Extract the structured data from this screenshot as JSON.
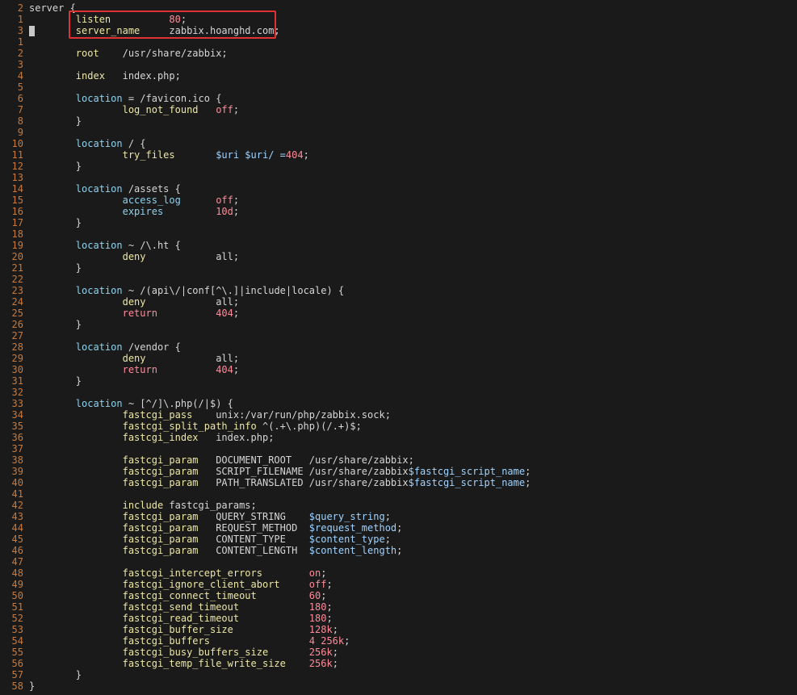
{
  "lines": [
    {
      "num": "2",
      "tokens": [
        {
          "t": "server {",
          "c": "plain"
        }
      ]
    },
    {
      "num": "1",
      "tokens": [
        {
          "t": "        listen          ",
          "c": "kw"
        },
        {
          "t": "80",
          "c": "num"
        },
        {
          "t": ";",
          "c": "plain"
        }
      ]
    },
    {
      "num": "3",
      "tokens": [
        {
          "t": "        server_name     ",
          "c": "kw"
        },
        {
          "t": "zabbix.hoanghd.com;",
          "c": "plain"
        }
      ]
    },
    {
      "num": "1",
      "tokens": []
    },
    {
      "num": "2",
      "tokens": [
        {
          "t": "        root    ",
          "c": "kw"
        },
        {
          "t": "/usr/share/zabbix;",
          "c": "plain"
        }
      ]
    },
    {
      "num": "3",
      "tokens": []
    },
    {
      "num": "4",
      "tokens": [
        {
          "t": "        index   ",
          "c": "kw"
        },
        {
          "t": "index.php;",
          "c": "plain"
        }
      ]
    },
    {
      "num": "5",
      "tokens": []
    },
    {
      "num": "6",
      "tokens": [
        {
          "t": "        location ",
          "c": "dir"
        },
        {
          "t": "= /favicon.ico {",
          "c": "plain"
        }
      ]
    },
    {
      "num": "7",
      "tokens": [
        {
          "t": "                log_not_found   ",
          "c": "kw"
        },
        {
          "t": "off",
          "c": "num"
        },
        {
          "t": ";",
          "c": "plain"
        }
      ]
    },
    {
      "num": "8",
      "tokens": [
        {
          "t": "        }",
          "c": "plain"
        }
      ]
    },
    {
      "num": "9",
      "tokens": []
    },
    {
      "num": "10",
      "tokens": [
        {
          "t": "        location ",
          "c": "dir"
        },
        {
          "t": "/ {",
          "c": "plain"
        }
      ]
    },
    {
      "num": "11",
      "tokens": [
        {
          "t": "                try_files       ",
          "c": "kw"
        },
        {
          "t": "$uri $uri/ =",
          "c": "var"
        },
        {
          "t": "404",
          "c": "num"
        },
        {
          "t": ";",
          "c": "plain"
        }
      ]
    },
    {
      "num": "12",
      "tokens": [
        {
          "t": "        }",
          "c": "plain"
        }
      ]
    },
    {
      "num": "13",
      "tokens": []
    },
    {
      "num": "14",
      "tokens": [
        {
          "t": "        location ",
          "c": "dir"
        },
        {
          "t": "/assets {",
          "c": "plain"
        }
      ]
    },
    {
      "num": "15",
      "tokens": [
        {
          "t": "                access_log      ",
          "c": "dir"
        },
        {
          "t": "off",
          "c": "num"
        },
        {
          "t": ";",
          "c": "plain"
        }
      ]
    },
    {
      "num": "16",
      "tokens": [
        {
          "t": "                expires         ",
          "c": "dir"
        },
        {
          "t": "10d",
          "c": "num"
        },
        {
          "t": ";",
          "c": "plain"
        }
      ]
    },
    {
      "num": "17",
      "tokens": [
        {
          "t": "        }",
          "c": "plain"
        }
      ]
    },
    {
      "num": "18",
      "tokens": []
    },
    {
      "num": "19",
      "tokens": [
        {
          "t": "        location ",
          "c": "dir"
        },
        {
          "t": "~ /\\.ht {",
          "c": "plain"
        }
      ]
    },
    {
      "num": "20",
      "tokens": [
        {
          "t": "                deny            ",
          "c": "kw"
        },
        {
          "t": "all;",
          "c": "plain"
        }
      ]
    },
    {
      "num": "21",
      "tokens": [
        {
          "t": "        }",
          "c": "plain"
        }
      ]
    },
    {
      "num": "22",
      "tokens": []
    },
    {
      "num": "23",
      "tokens": [
        {
          "t": "        location ",
          "c": "dir"
        },
        {
          "t": "~ /(api\\/|conf[^\\.]|include|locale) {",
          "c": "plain"
        }
      ]
    },
    {
      "num": "24",
      "tokens": [
        {
          "t": "                deny            ",
          "c": "kw"
        },
        {
          "t": "all;",
          "c": "plain"
        }
      ]
    },
    {
      "num": "25",
      "tokens": [
        {
          "t": "                return          ",
          "c": "num"
        },
        {
          "t": "404",
          "c": "num"
        },
        {
          "t": ";",
          "c": "plain"
        }
      ]
    },
    {
      "num": "26",
      "tokens": [
        {
          "t": "        }",
          "c": "plain"
        }
      ]
    },
    {
      "num": "27",
      "tokens": []
    },
    {
      "num": "28",
      "tokens": [
        {
          "t": "        location ",
          "c": "dir"
        },
        {
          "t": "/vendor {",
          "c": "plain"
        }
      ]
    },
    {
      "num": "29",
      "tokens": [
        {
          "t": "                deny            ",
          "c": "kw"
        },
        {
          "t": "all;",
          "c": "plain"
        }
      ]
    },
    {
      "num": "30",
      "tokens": [
        {
          "t": "                return          ",
          "c": "num"
        },
        {
          "t": "404",
          "c": "num"
        },
        {
          "t": ";",
          "c": "plain"
        }
      ]
    },
    {
      "num": "31",
      "tokens": [
        {
          "t": "        }",
          "c": "plain"
        }
      ]
    },
    {
      "num": "32",
      "tokens": []
    },
    {
      "num": "33",
      "tokens": [
        {
          "t": "        location ",
          "c": "dir"
        },
        {
          "t": "~ [^/]\\.php(/|$) {",
          "c": "plain"
        }
      ]
    },
    {
      "num": "34",
      "tokens": [
        {
          "t": "                fastcgi_pass    ",
          "c": "kw"
        },
        {
          "t": "unix:/var/run/php/zabbix.sock;",
          "c": "plain"
        }
      ]
    },
    {
      "num": "35",
      "tokens": [
        {
          "t": "                fastcgi_split_path_info ",
          "c": "kw"
        },
        {
          "t": "^(.+\\.php)(/.+)$;",
          "c": "plain"
        }
      ]
    },
    {
      "num": "36",
      "tokens": [
        {
          "t": "                fastcgi_index   ",
          "c": "kw"
        },
        {
          "t": "index.php;",
          "c": "plain"
        }
      ]
    },
    {
      "num": "37",
      "tokens": []
    },
    {
      "num": "38",
      "tokens": [
        {
          "t": "                fastcgi_param   ",
          "c": "kw"
        },
        {
          "t": "DOCUMENT_ROOT   /usr/share/zabbix;",
          "c": "plain"
        }
      ]
    },
    {
      "num": "39",
      "tokens": [
        {
          "t": "                fastcgi_param   ",
          "c": "kw"
        },
        {
          "t": "SCRIPT_FILENAME /usr/share/zabbix",
          "c": "plain"
        },
        {
          "t": "$fastcgi_script_name",
          "c": "var"
        },
        {
          "t": ";",
          "c": "plain"
        }
      ]
    },
    {
      "num": "40",
      "tokens": [
        {
          "t": "                fastcgi_param   ",
          "c": "kw"
        },
        {
          "t": "PATH_TRANSLATED /usr/share/zabbix",
          "c": "plain"
        },
        {
          "t": "$fastcgi_script_name",
          "c": "var"
        },
        {
          "t": ";",
          "c": "plain"
        }
      ]
    },
    {
      "num": "41",
      "tokens": []
    },
    {
      "num": "42",
      "tokens": [
        {
          "t": "                include ",
          "c": "kw"
        },
        {
          "t": "fastcgi_params;",
          "c": "plain"
        }
      ]
    },
    {
      "num": "43",
      "tokens": [
        {
          "t": "                fastcgi_param   ",
          "c": "kw"
        },
        {
          "t": "QUERY_STRING    ",
          "c": "plain"
        },
        {
          "t": "$query_string",
          "c": "var"
        },
        {
          "t": ";",
          "c": "plain"
        }
      ]
    },
    {
      "num": "44",
      "tokens": [
        {
          "t": "                fastcgi_param   ",
          "c": "kw"
        },
        {
          "t": "REQUEST_METHOD  ",
          "c": "plain"
        },
        {
          "t": "$request_method",
          "c": "var"
        },
        {
          "t": ";",
          "c": "plain"
        }
      ]
    },
    {
      "num": "45",
      "tokens": [
        {
          "t": "                fastcgi_param   ",
          "c": "kw"
        },
        {
          "t": "CONTENT_TYPE    ",
          "c": "plain"
        },
        {
          "t": "$content_type",
          "c": "var"
        },
        {
          "t": ";",
          "c": "plain"
        }
      ]
    },
    {
      "num": "46",
      "tokens": [
        {
          "t": "                fastcgi_param   ",
          "c": "kw"
        },
        {
          "t": "CONTENT_LENGTH  ",
          "c": "plain"
        },
        {
          "t": "$content_length",
          "c": "var"
        },
        {
          "t": ";",
          "c": "plain"
        }
      ]
    },
    {
      "num": "47",
      "tokens": []
    },
    {
      "num": "48",
      "tokens": [
        {
          "t": "                fastcgi_intercept_errors        ",
          "c": "kw"
        },
        {
          "t": "on",
          "c": "num"
        },
        {
          "t": ";",
          "c": "plain"
        }
      ]
    },
    {
      "num": "49",
      "tokens": [
        {
          "t": "                fastcgi_ignore_client_abort     ",
          "c": "kw"
        },
        {
          "t": "off",
          "c": "num"
        },
        {
          "t": ";",
          "c": "plain"
        }
      ]
    },
    {
      "num": "50",
      "tokens": [
        {
          "t": "                fastcgi_connect_timeout         ",
          "c": "kw"
        },
        {
          "t": "60",
          "c": "num"
        },
        {
          "t": ";",
          "c": "plain"
        }
      ]
    },
    {
      "num": "51",
      "tokens": [
        {
          "t": "                fastcgi_send_timeout            ",
          "c": "kw"
        },
        {
          "t": "180",
          "c": "num"
        },
        {
          "t": ";",
          "c": "plain"
        }
      ]
    },
    {
      "num": "52",
      "tokens": [
        {
          "t": "                fastcgi_read_timeout            ",
          "c": "kw"
        },
        {
          "t": "180",
          "c": "num"
        },
        {
          "t": ";",
          "c": "plain"
        }
      ]
    },
    {
      "num": "53",
      "tokens": [
        {
          "t": "                fastcgi_buffer_size             ",
          "c": "kw"
        },
        {
          "t": "128k",
          "c": "num"
        },
        {
          "t": ";",
          "c": "plain"
        }
      ]
    },
    {
      "num": "54",
      "tokens": [
        {
          "t": "                fastcgi_buffers                 ",
          "c": "kw"
        },
        {
          "t": "4 256k",
          "c": "num"
        },
        {
          "t": ";",
          "c": "plain"
        }
      ]
    },
    {
      "num": "55",
      "tokens": [
        {
          "t": "                fastcgi_busy_buffers_size       ",
          "c": "kw"
        },
        {
          "t": "256k",
          "c": "num"
        },
        {
          "t": ";",
          "c": "plain"
        }
      ]
    },
    {
      "num": "56",
      "tokens": [
        {
          "t": "                fastcgi_temp_file_write_size    ",
          "c": "kw"
        },
        {
          "t": "256k",
          "c": "num"
        },
        {
          "t": ";",
          "c": "plain"
        }
      ]
    },
    {
      "num": "57",
      "tokens": [
        {
          "t": "        }",
          "c": "plain"
        }
      ]
    },
    {
      "num": "58",
      "tokens": [
        {
          "t": "}",
          "c": "plain"
        }
      ]
    }
  ],
  "colors": {
    "background": "#1a1a1a",
    "line_number": "#c77a3c",
    "keyword": "#ede7a6",
    "directive": "#8fd3ee",
    "number": "#ff8b9a",
    "variable": "#9fd3ff",
    "plain": "#d6d6d6",
    "highlight_border": "#e03232"
  }
}
